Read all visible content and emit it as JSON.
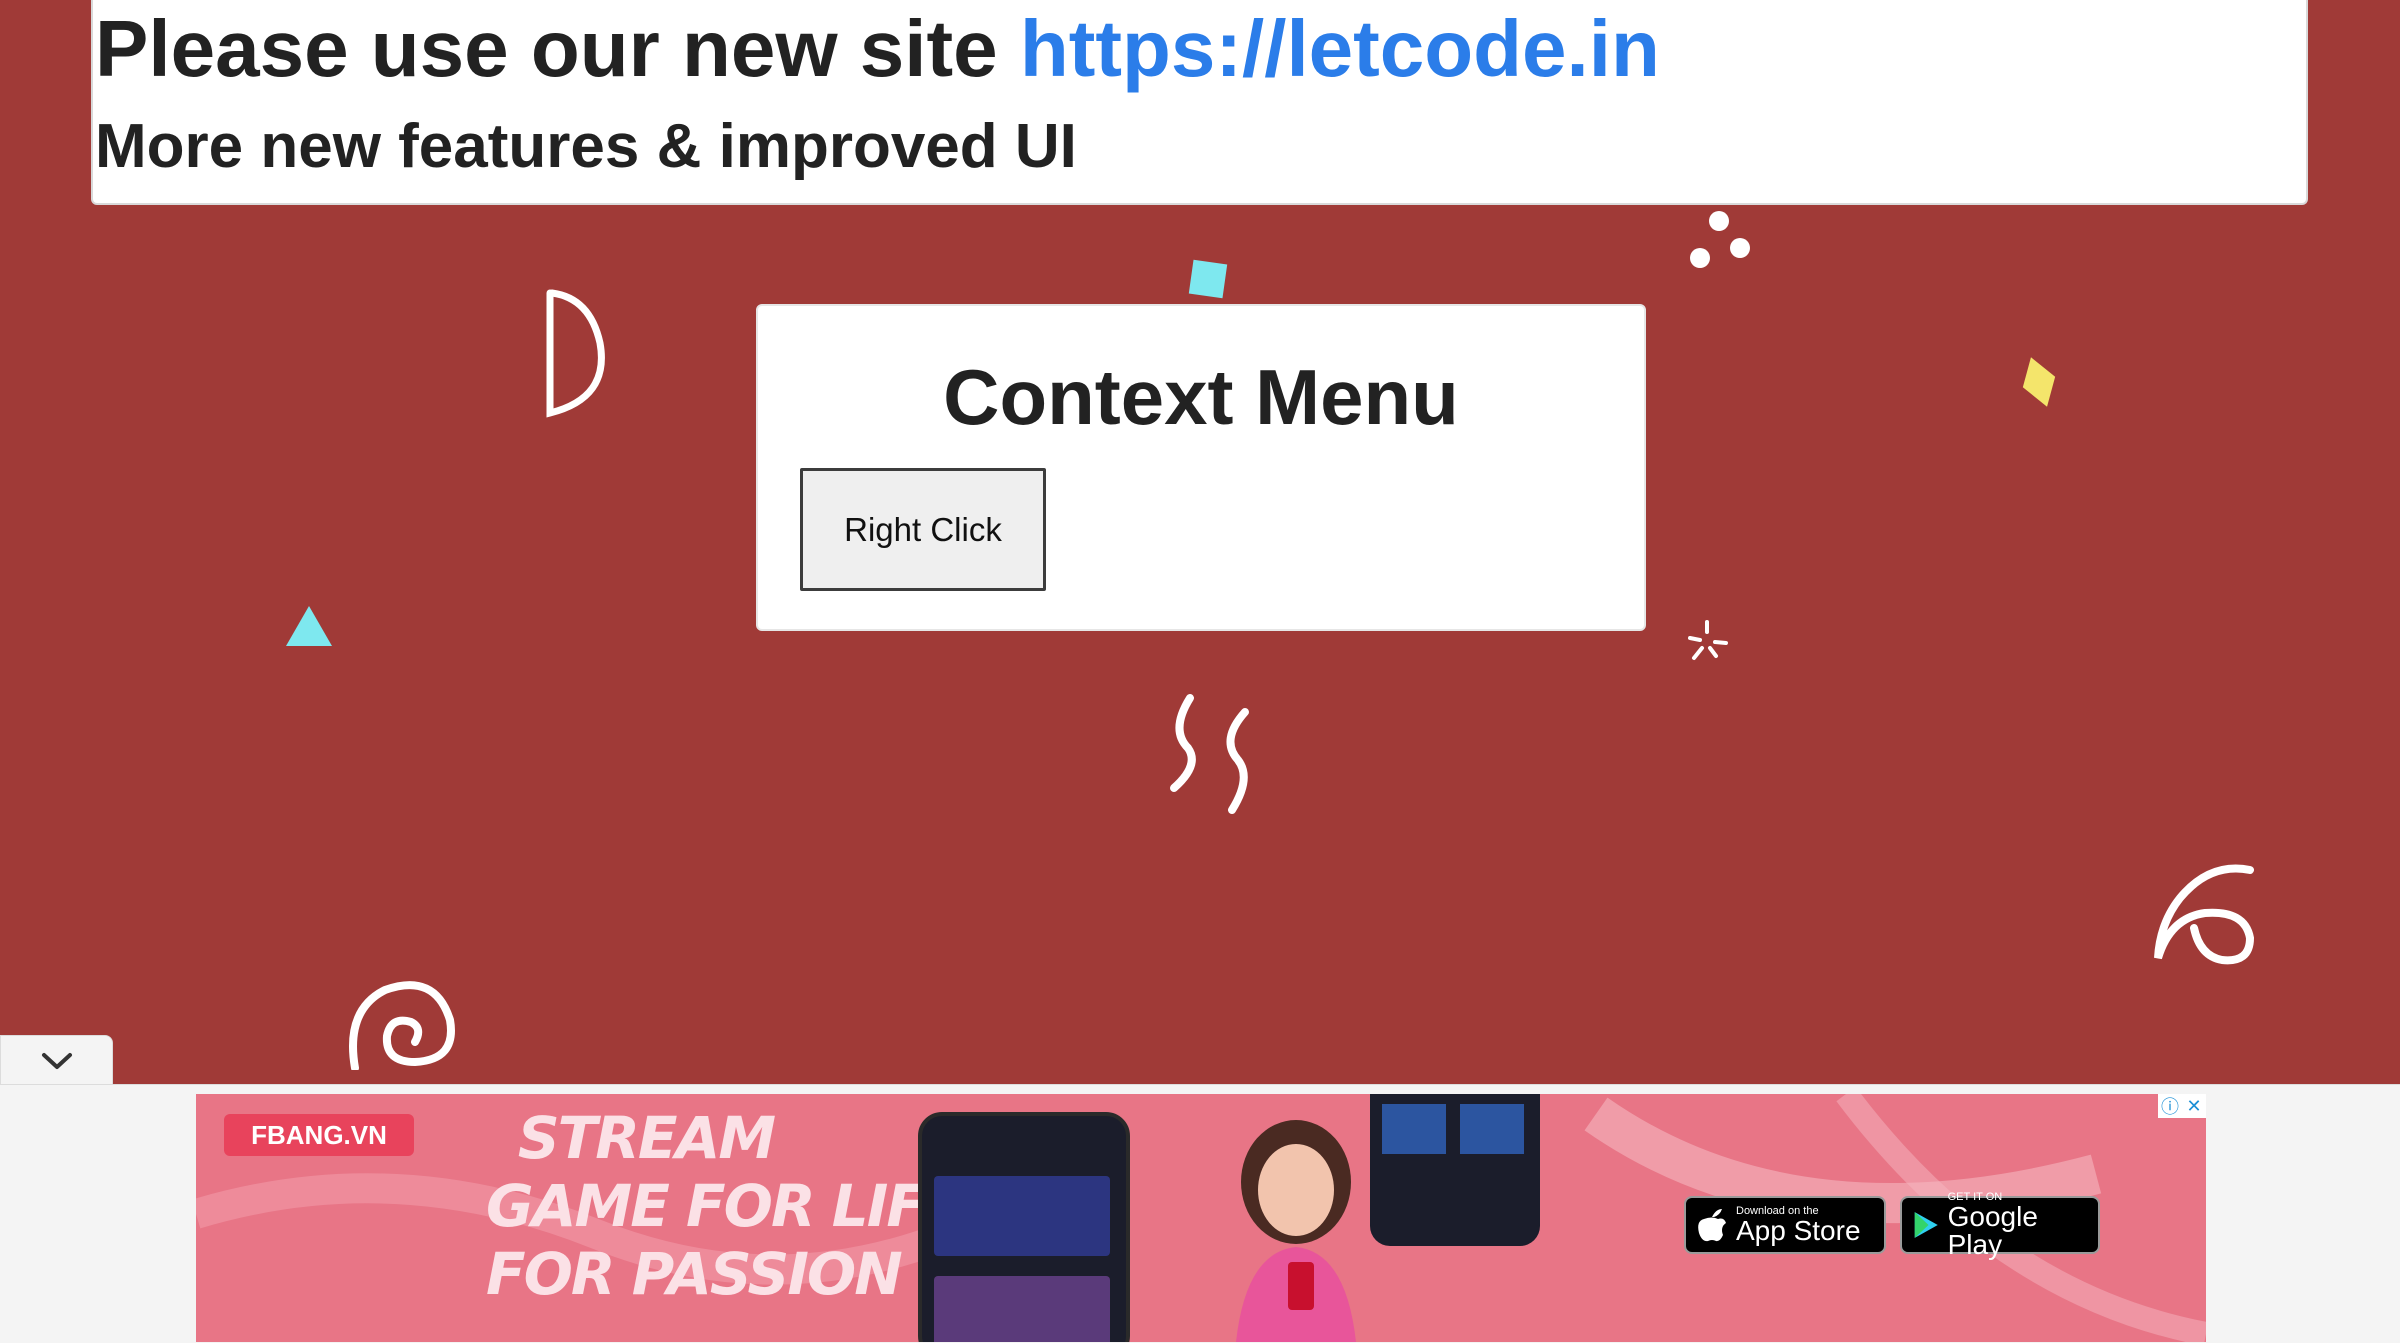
{
  "banner": {
    "line1_text": "Please use our new site ",
    "line1_link": "https://letcode.in",
    "line2_text": "More new features & improved UI"
  },
  "card": {
    "title": "Context Menu",
    "button_label": "Right Click"
  },
  "ad": {
    "brand": "FBANG.VN",
    "slogan_lines": [
      "STREAM",
      "GAME FOR LIFE",
      "FOR PASSION"
    ],
    "app_store_small": "Download on the",
    "app_store_big": "App Store",
    "google_play_small": "GET IT ON",
    "google_play_big": "Google Play",
    "info_icon": "ⓘ",
    "close_icon": "✕"
  },
  "colors": {
    "page_background": "#a03a37",
    "link": "#2b7de9",
    "ad_background": "#e87586"
  },
  "icons": [
    "chevron-down-icon",
    "info-icon",
    "close-icon",
    "apple-icon",
    "play-icon"
  ]
}
